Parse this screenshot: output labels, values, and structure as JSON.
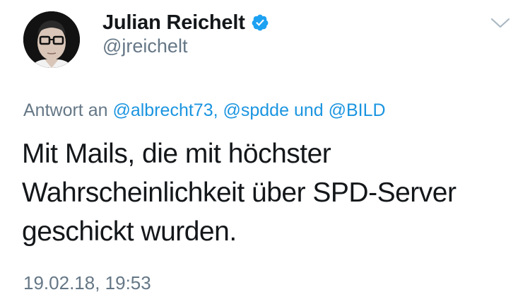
{
  "author": {
    "display_name": "Julian Reichelt",
    "handle": "@jreichelt",
    "verified": true
  },
  "reply": {
    "prefix": "Antwort an",
    "mention_1": "@albrecht73,",
    "mention_2": "@spdde",
    "joiner": "und",
    "mention_3": "@BILD"
  },
  "tweet": {
    "lines": [
      "Mit Mails, die mit höchster",
      "Wahrscheinlichkeit über SPD-Server",
      "geschickt wurden."
    ],
    "timestamp": "19.02.18, 19:53"
  },
  "colors": {
    "link": "#1b95e0",
    "secondary_text": "#657786",
    "primary_text": "#14171a",
    "verified_badge": "#1da1f2"
  },
  "icons": {
    "verified": "verified-badge-icon",
    "menu": "chevron-down-icon"
  }
}
